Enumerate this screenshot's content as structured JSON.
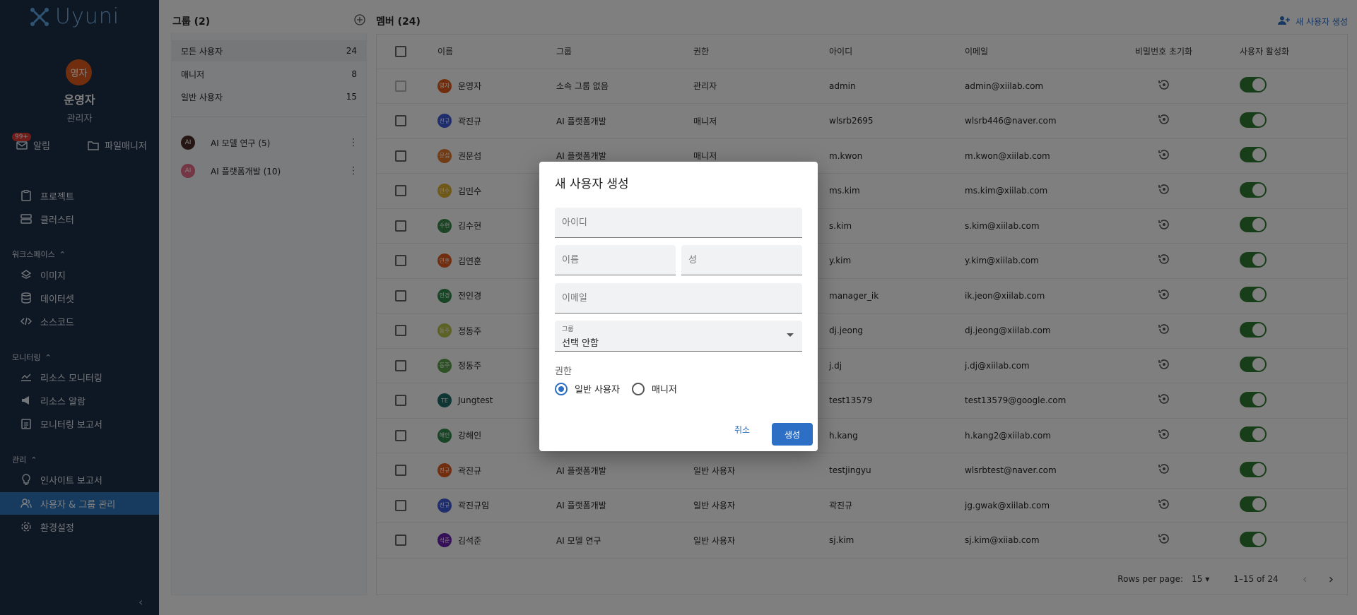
{
  "app": {
    "logo_text": "Uyuni"
  },
  "profile": {
    "avatar_text": "영자",
    "name": "운영자",
    "role": "관리자"
  },
  "quick": {
    "alerts_label": "알림",
    "alerts_badge": "99+",
    "files_label": "파일매니저"
  },
  "nav": {
    "projects": "프로젝트",
    "clusters": "클러스터",
    "workspace_section": "워크스페이스",
    "images": "이미지",
    "datasets": "데이터셋",
    "sourcecode": "소스코드",
    "monitoring_section": "모니터링",
    "resource_monitoring": "리소스 모니터링",
    "resource_alerts": "리소스 알람",
    "monitoring_report": "모니터링 보고서",
    "admin_section": "관리",
    "insight_report": "인사이트 보고서",
    "user_group_mgmt": "사용자 & 그룹 관리",
    "settings": "환경설정"
  },
  "groups": {
    "title": "그룹 (2)",
    "filters": [
      {
        "label": "모든 사용자",
        "count": "24"
      },
      {
        "label": "매니저",
        "count": "8"
      },
      {
        "label": "일반 사용자",
        "count": "15"
      }
    ],
    "items": [
      {
        "avatar": "AI",
        "label": "AI 모델 연구 (5)",
        "color": "#4a2b26"
      },
      {
        "avatar": "AI",
        "label": "AI 플랫폼개발 (10)",
        "color": "#e86a8a"
      }
    ]
  },
  "members": {
    "title": "멤버 (24)",
    "new_user_label": "새 사용자 생성",
    "columns": [
      "이름",
      "그룹",
      "권한",
      "아이디",
      "이메일",
      "비밀번호 초기화",
      "사용자 활성화"
    ],
    "rows": [
      {
        "av": "영자",
        "color": "#e35d1e",
        "name": "운영자",
        "group": "소속 그룹 없음",
        "role": "관리자",
        "id": "admin",
        "email": "admin@xiilab.com"
      },
      {
        "av": "진규",
        "color": "#3d5ad6",
        "name": "곽진규",
        "group": "AI 플랫폼개발",
        "role": "매니저",
        "id": "wlsrb2695",
        "email": "wlsrb446@naver.com"
      },
      {
        "av": "문섭",
        "color": "#e3782a",
        "name": "권문섭",
        "group": "AI 플랫폼개발",
        "role": "매니저",
        "id": "m.kwon",
        "email": "m.kwon@xiilab.com"
      },
      {
        "av": "민수",
        "color": "#e0b030",
        "name": "김민수",
        "group": "",
        "role": "",
        "id": "ms.kim",
        "email": "ms.kim@xiilab.com"
      },
      {
        "av": "수현",
        "color": "#3b8a4a",
        "name": "김수현",
        "group": "",
        "role": "",
        "id": "s.kim",
        "email": "s.kim@xiilab.com"
      },
      {
        "av": "연훈",
        "color": "#e35d1e",
        "name": "김연훈",
        "group": "",
        "role": "",
        "id": "y.kim",
        "email": "y.kim@xiilab.com"
      },
      {
        "av": "인경",
        "color": "#2f8a4a",
        "name": "전인경",
        "group": "",
        "role": "",
        "id": "manager_ik",
        "email": "ik.jeon@xiilab.com"
      },
      {
        "av": "동주",
        "color": "#b9c44a",
        "name": "정동주",
        "group": "",
        "role": "",
        "id": "dj.jeong",
        "email": "dj.jeong@xiilab.com"
      },
      {
        "av": "동주",
        "color": "#5aa04a",
        "name": "정동주",
        "group": "",
        "role": "",
        "id": "j.dj",
        "email": "j.dj@xiilab.com"
      },
      {
        "av": "TE",
        "color": "#1d6d6a",
        "name": "Jungtest",
        "group": "",
        "role": "",
        "id": "test13579",
        "email": "test13579@google.com"
      },
      {
        "av": "해인",
        "color": "#2f8a4a",
        "name": "강해인",
        "group": "",
        "role": "",
        "id": "h.kang",
        "email": "h.kang2@xiilab.com"
      },
      {
        "av": "진규",
        "color": "#e35d1e",
        "name": "곽진규",
        "group": "AI 플랫폼개발",
        "role": "일반 사용자",
        "id": "testjingyu",
        "email": "wlsrbtest@naver.com"
      },
      {
        "av": "진규",
        "color": "#3d5ad6",
        "name": "곽진규임",
        "group": "AI 플랫폼개발",
        "role": "일반 사용자",
        "id": "곽진규",
        "email": "jg.gwak@xiilab.com"
      },
      {
        "av": "석준",
        "color": "#6a1fb0",
        "name": "김석준",
        "group": "AI 모델 연구",
        "role": "일반 사용자",
        "id": "sj.kim",
        "email": "sj.kim@xiiab.com"
      }
    ],
    "pager": {
      "rows_per_page_label": "Rows per page:",
      "rows_per_page_value": "15",
      "range": "1–15 of 24"
    }
  },
  "dialog": {
    "title": "새 사용자 생성",
    "id_placeholder": "아이디",
    "first_name_placeholder": "이름",
    "last_name_placeholder": "성",
    "email_placeholder": "이메일",
    "group_label": "그룹",
    "group_value": "선택 안함",
    "permission_label": "권한",
    "radio_general": "일반 사용자",
    "radio_manager": "매니저",
    "cancel": "취소",
    "create": "생성"
  },
  "colors": {
    "sidebar": "#1d2f48",
    "accent": "#2e6fc6",
    "toggle_on": "#2e7d32"
  }
}
